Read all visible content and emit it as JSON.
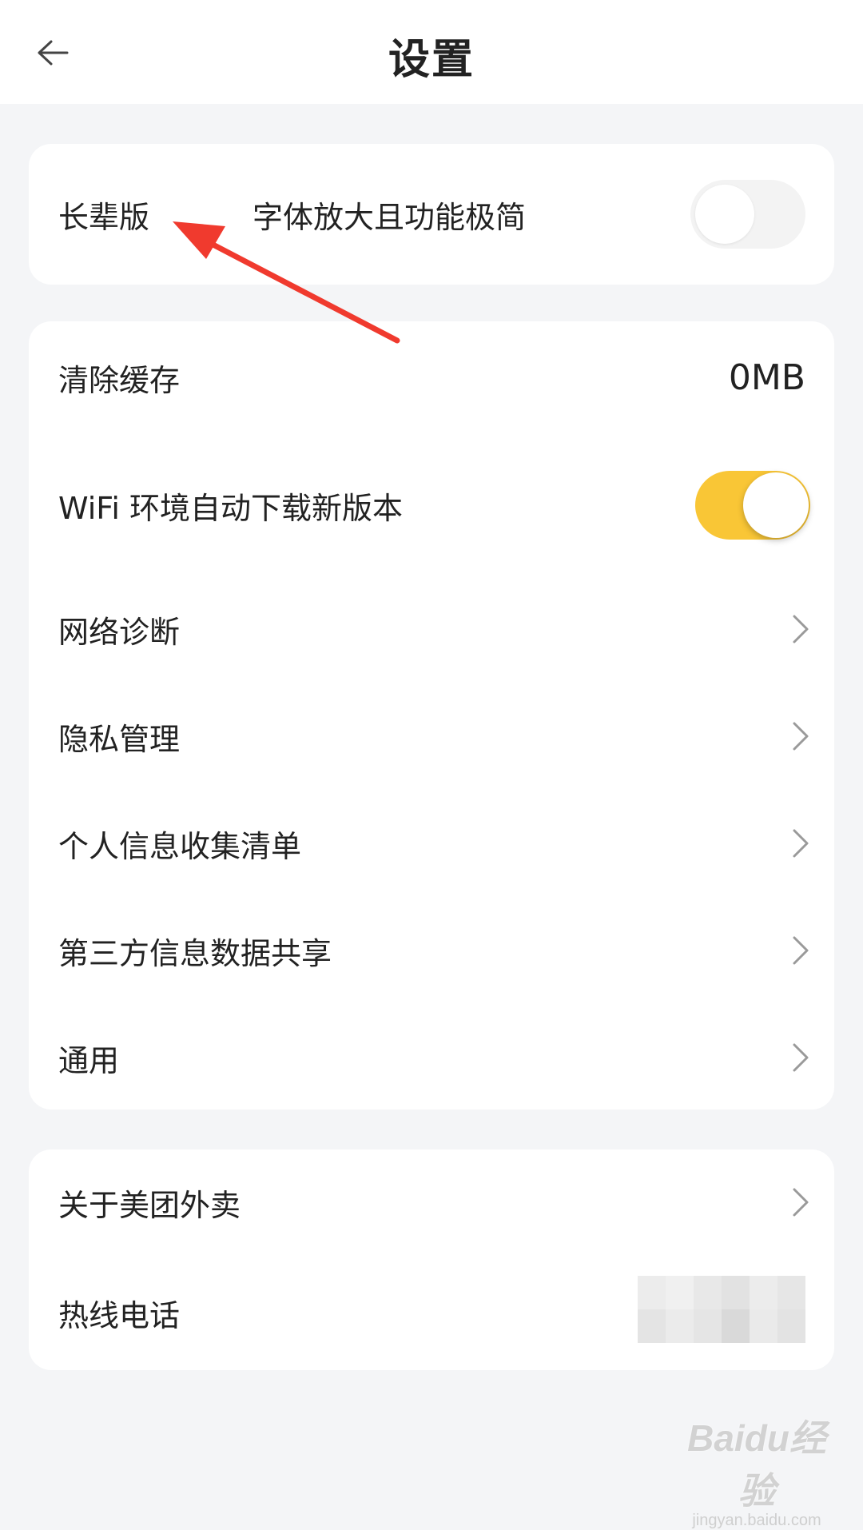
{
  "header": {
    "title": "设置"
  },
  "elder_card": {
    "label": "长辈版",
    "description": "字体放大且功能极简",
    "toggle_on": false
  },
  "main_card": {
    "clear_cache": {
      "label": "清除缓存",
      "value": "0MB"
    },
    "wifi_update": {
      "label": "WiFi 环境自动下载新版本",
      "toggle_on": true
    },
    "items": [
      {
        "label": "网络诊断"
      },
      {
        "label": "隐私管理"
      },
      {
        "label": "个人信息收集清单"
      },
      {
        "label": "第三方信息数据共享"
      },
      {
        "label": "通用"
      }
    ]
  },
  "about_card": {
    "about": {
      "label": "关于美团外卖"
    },
    "hotline": {
      "label": "热线电话"
    }
  },
  "watermark": {
    "brand": "Baidu经验",
    "url": "jingyan.baidu.com"
  },
  "colors": {
    "toggle_on": "#f9c636",
    "background": "#f4f5f7",
    "annotation_arrow": "#f03a2e"
  }
}
